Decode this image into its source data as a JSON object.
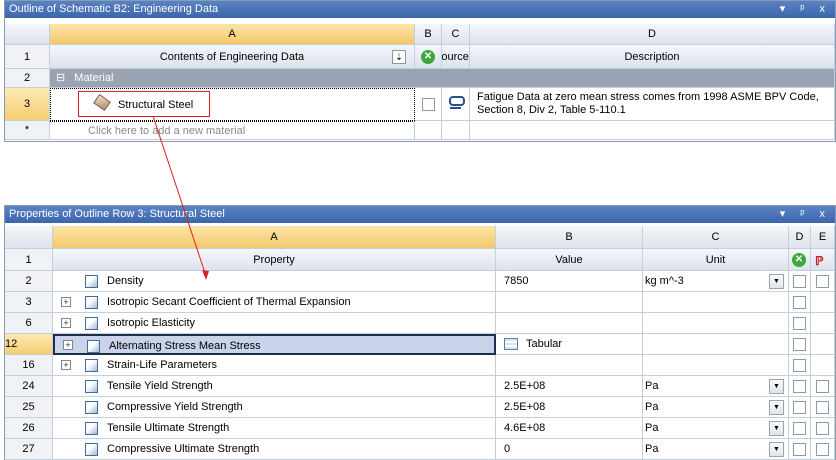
{
  "outline": {
    "title": "Outline of Schematic B2: Engineering Data",
    "window_controls": [
      "▾",
      "ᵖ",
      "x"
    ],
    "columns": [
      "A",
      "B",
      "C",
      "D"
    ],
    "header": {
      "row_num": "1",
      "contents": "Contents of Engineering Data",
      "source": "Source",
      "description": "Description"
    },
    "group": {
      "row_num": "2",
      "label": "Material",
      "toggle": "⊟"
    },
    "material_row": {
      "row_num": "3",
      "name": "Structural Steel",
      "description_line1": "Fatigue Data at zero mean stress comes from 1998 ASME BPV Code,",
      "description_line2": "Section 8, Div 2, Table 5-110.1"
    },
    "new_row": {
      "row_num": "*",
      "hint": "Click here to add a new material"
    }
  },
  "properties": {
    "title": "Properties of Outline Row 3: Structural Steel",
    "window_controls": [
      "▾",
      "ᵖ",
      "x"
    ],
    "columns": [
      "A",
      "B",
      "C",
      "D",
      "E"
    ],
    "header": {
      "row_num": "1",
      "property": "Property",
      "value": "Value",
      "unit": "Unit"
    },
    "rows": [
      {
        "num": "2",
        "expand": false,
        "name": "Density",
        "value": "7850",
        "unit": "kg m^-3",
        "has_dd": true,
        "has_e": true
      },
      {
        "num": "3",
        "expand": true,
        "name": "Isotropic Secant Coefficient of Thermal Expansion",
        "value": "",
        "unit": "",
        "has_dd": false,
        "has_e": false
      },
      {
        "num": "6",
        "expand": true,
        "name": "Isotropic Elasticity",
        "value": "",
        "unit": "",
        "has_dd": false,
        "has_e": false
      },
      {
        "num": "12",
        "expand": true,
        "name": "Alternating Stress Mean Stress",
        "value": "Tabular",
        "unit": "",
        "has_dd": false,
        "has_e": false,
        "selected": true
      },
      {
        "num": "16",
        "expand": true,
        "name": "Strain-Life Parameters",
        "value": "",
        "unit": "",
        "has_dd": false,
        "has_e": false
      },
      {
        "num": "24",
        "expand": false,
        "name": "Tensile Yield Strength",
        "value": "2.5E+08",
        "unit": "Pa",
        "has_dd": true,
        "has_e": true
      },
      {
        "num": "25",
        "expand": false,
        "name": "Compressive Yield Strength",
        "value": "2.5E+08",
        "unit": "Pa",
        "has_dd": true,
        "has_e": true
      },
      {
        "num": "26",
        "expand": false,
        "name": "Tensile Ultimate Strength",
        "value": "4.6E+08",
        "unit": "Pa",
        "has_dd": true,
        "has_e": true
      },
      {
        "num": "27",
        "expand": false,
        "name": "Compressive Ultimate Strength",
        "value": "0",
        "unit": "Pa",
        "has_dd": true,
        "has_e": true
      }
    ]
  },
  "colors": {
    "title_bar": "#3c66ac",
    "selected_header": "#f5c96b",
    "annotation": "#e02020"
  }
}
